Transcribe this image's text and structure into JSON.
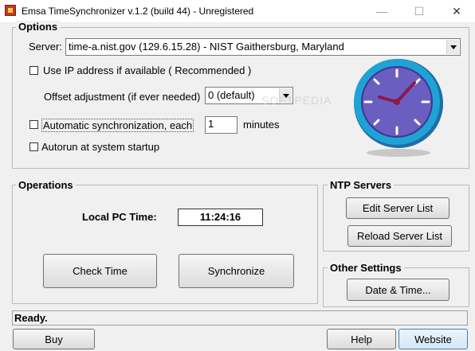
{
  "window": {
    "title": "Emsa TimeSynchronizer v.1.2  (build 44) - Unregistered",
    "minimize": "—",
    "maximize": "☐",
    "close": "✕"
  },
  "options": {
    "group_title": "Options",
    "server_label": "Server:",
    "server_value": "time-a.nist.gov (129.6.15.28)  - NIST Gaithersburg, Maryland",
    "use_ip_label": "Use IP address if available ( Recommended )",
    "offset_label": "Offset adjustment  (if ever needed)",
    "offset_value": "0 (default)",
    "auto_sync_label": "Automatic synchronization,  each",
    "auto_sync_value": "1",
    "minutes_label": "minutes",
    "autorun_label": "Autorun at system startup",
    "watermark": "SOFTPEDIA"
  },
  "operations": {
    "group_title": "Operations",
    "local_time_label": "Local PC Time:",
    "local_time_value": "11:24:16",
    "check_time": "Check Time",
    "synchronize": "Synchronize"
  },
  "ntp": {
    "group_title": "NTP Servers",
    "edit": "Edit Server List",
    "reload": "Reload Server List"
  },
  "other": {
    "group_title": "Other Settings",
    "date_time": "Date & Time..."
  },
  "status": {
    "text": "Ready."
  },
  "bottom": {
    "buy": "Buy",
    "help": "Help",
    "website": "Website"
  },
  "colors": {
    "clock_ring": "#1fa3d6",
    "clock_face": "#6a5fc1",
    "clock_hands": "#8a1a4a"
  }
}
